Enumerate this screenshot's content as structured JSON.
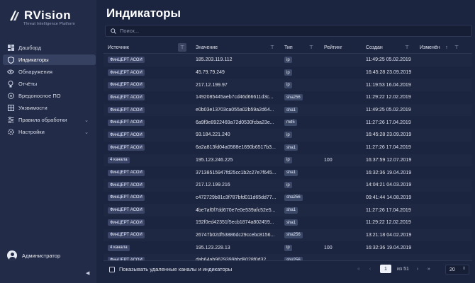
{
  "app": {
    "logo_text": "RVision",
    "logo_sub": "Threat Intelligence Platform"
  },
  "sidebar": {
    "items": [
      {
        "label": "Дашборд",
        "icon": "dashboard-icon"
      },
      {
        "label": "Индикаторы",
        "icon": "shield-icon",
        "active": true
      },
      {
        "label": "Обнаружения",
        "icon": "eye-icon"
      },
      {
        "label": "Отчёты",
        "icon": "lightbulb-icon"
      },
      {
        "label": "Вредоносное ПО",
        "icon": "bug-icon"
      },
      {
        "label": "Уязвимости",
        "icon": "grid-icon"
      },
      {
        "label": "Правила обработки",
        "icon": "rules-icon",
        "expandable": true
      },
      {
        "label": "Настройки",
        "icon": "settings-icon",
        "expandable": true
      }
    ],
    "user": "Администратор"
  },
  "main": {
    "title": "Индикаторы",
    "search_placeholder": "Поиск..."
  },
  "table": {
    "columns": [
      "Источник",
      "Значение",
      "Тип",
      "Рейтинг",
      "Создан",
      "Изменён"
    ],
    "rows": [
      {
        "source": "ФинЦЕРТ АСОИ",
        "value": "185.203.119.112",
        "type": "ip",
        "rating": "",
        "created": "11:49:25 05.02.2019"
      },
      {
        "source": "ФинЦЕРТ АСОИ",
        "value": "45.79.79.249",
        "type": "ip",
        "rating": "",
        "created": "16:45:28 23.09.2019"
      },
      {
        "source": "ФинЦЕРТ АСОИ",
        "value": "217.12.199.97",
        "type": "ip",
        "rating": "",
        "created": "11:19:53 16.04.2019"
      },
      {
        "source": "ФинЦЕРТ АСОИ",
        "value": "1492085445aeb7cd46d66611d3c...",
        "type": "sha256",
        "rating": "",
        "created": "11:29:22 12.02.2019"
      },
      {
        "source": "ФинЦЕРТ АСОИ",
        "value": "e0b03e13703ca055a02b59a2d64...",
        "type": "sha1",
        "rating": "",
        "created": "11:49:25 05.02.2019"
      },
      {
        "source": "ФинЦЕРТ АСОИ",
        "value": "6a9f9e8922469a72d0530fcba23e...",
        "type": "md5",
        "rating": "",
        "created": "11:27:26 17.04.2019"
      },
      {
        "source": "ФинЦЕРТ АСОИ",
        "value": "93.184.221.240",
        "type": "ip",
        "rating": "",
        "created": "16:45:28 23.09.2019"
      },
      {
        "source": "ФинЦЕРТ АСОИ",
        "value": "6a2a813fd04a0588e1690b6517b3...",
        "type": "sha1",
        "rating": "",
        "created": "11:27:26 17.04.2019"
      },
      {
        "source": "4 канала",
        "value": "195.123.246.225",
        "type": "ip",
        "rating": "100",
        "created": "16:37:59 12.07.2019"
      },
      {
        "source": "ФинЦЕРТ АСОИ",
        "value": "37138515947fd25cc1b2c27e7f645...",
        "type": "sha1",
        "rating": "",
        "created": "16:32:36 19.04.2019"
      },
      {
        "source": "ФинЦЕРТ АСОИ",
        "value": "217.12.199.216",
        "type": "ip",
        "rating": "",
        "created": "14:04:21 04.03.2019"
      },
      {
        "source": "ФинЦЕРТ АСОИ",
        "value": "c472729b81c3f787bfd011d65dd77...",
        "type": "sha256",
        "rating": "",
        "created": "09:41:44 14.08.2019"
      },
      {
        "source": "ФинЦЕРТ АСОИ",
        "value": "4be7af0f7dd670e7e0e539afc52e5...",
        "type": "sha1",
        "rating": "",
        "created": "11:27:26 17.04.2019"
      },
      {
        "source": "ФинЦЕРТ АСОИ",
        "value": "192f0ed42351f5ecb1874a802459...",
        "type": "sha1",
        "rating": "",
        "created": "11:29:22 12.02.2019"
      },
      {
        "source": "ФинЦЕРТ АСОИ",
        "value": "26747b02df53886dc29ccebc8156...",
        "type": "sha256",
        "rating": "",
        "created": "13:21:18 04.02.2019"
      },
      {
        "source": "4 канала",
        "value": "195.123.228.13",
        "type": "ip",
        "rating": "100",
        "created": "16:32:36 19.04.2019"
      },
      {
        "source": "ФинЦЕРТ АСОИ",
        "value": "dab64ab9629399bbd8028f0d32...",
        "type": "sha256",
        "rating": "",
        "created": ""
      }
    ]
  },
  "footer": {
    "show_deleted_label": "Показывать удаленные каналы и индикаторы",
    "page": "1",
    "of_pages": "из 51",
    "per_page": "20"
  }
}
